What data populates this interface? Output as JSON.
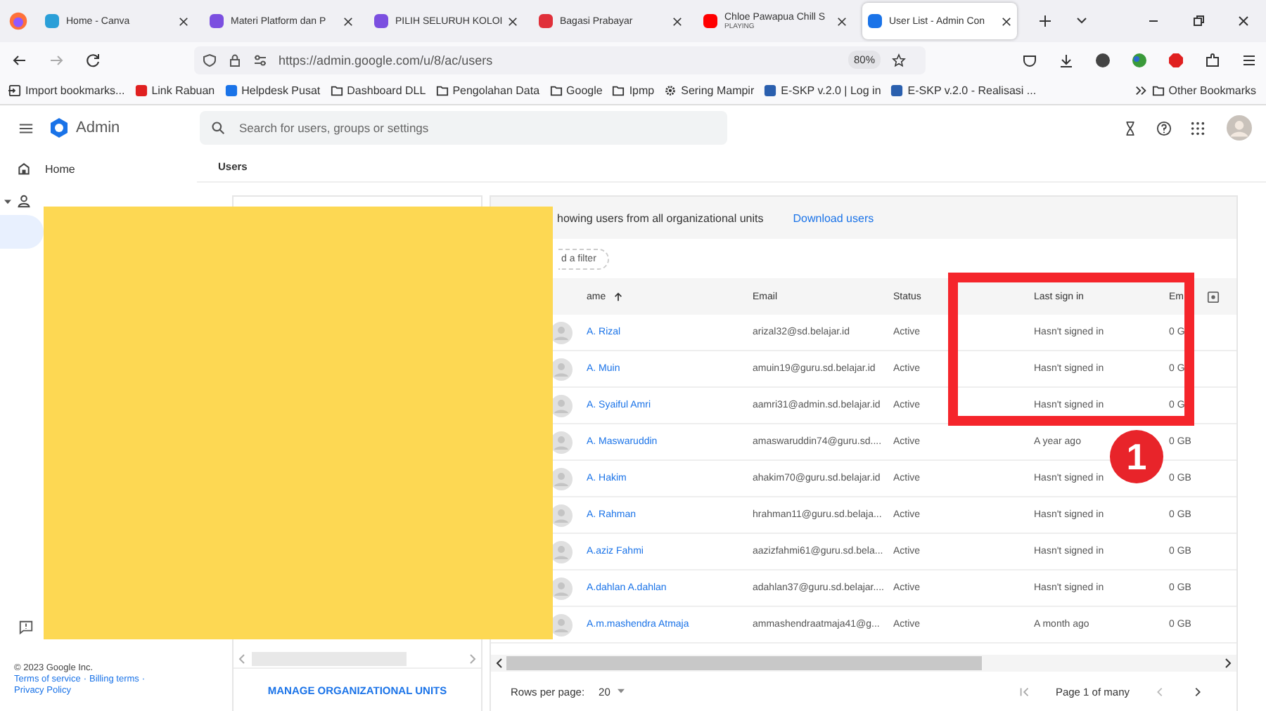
{
  "browser": {
    "tabs": [
      {
        "title": "Home - Canva",
        "selected": false,
        "color": "#2a9fd8"
      },
      {
        "title": "Materi Platform dan P",
        "selected": false,
        "color": "#7b4fe0"
      },
      {
        "title": "PILIH SELURUH KOLOI",
        "selected": false,
        "color": "#7b4fe0"
      },
      {
        "title": "Bagasi Prabayar",
        "selected": false,
        "color": "#e0303a"
      },
      {
        "title": "Chloe Pawapua Chill S",
        "subtitle": "PLAYING",
        "selected": false,
        "color": "#ff0000"
      },
      {
        "title": "User List - Admin Con",
        "selected": true,
        "color": "#1a73e8"
      }
    ],
    "address": "https://admin.google.com/u/8/ac/users",
    "zoom": "80%",
    "bookmarks": [
      {
        "label": "Import bookmarks...",
        "kind": "import"
      },
      {
        "label": "Link Rabuan",
        "kind": "site",
        "color": "#e02020"
      },
      {
        "label": "Helpdesk Pusat",
        "kind": "site",
        "color": "#1a73e8"
      },
      {
        "label": "Dashboard DLL",
        "kind": "folder"
      },
      {
        "label": "Pengolahan Data",
        "kind": "folder"
      },
      {
        "label": "Google",
        "kind": "folder"
      },
      {
        "label": "Ipmp",
        "kind": "folder"
      },
      {
        "label": "Sering Mampir",
        "kind": "gear"
      },
      {
        "label": "E-SKP v.2.0 | Log in",
        "kind": "site",
        "color": "#2a5fae"
      },
      {
        "label": "E-SKP v.2.0 - Realisasi ...",
        "kind": "site",
        "color": "#2a5fae"
      }
    ],
    "other_bookmarks": "Other Bookmarks"
  },
  "app": {
    "title": "Admin",
    "search": {
      "placeholder": "Search for users, groups or settings"
    }
  },
  "sidebar": {
    "items": [
      {
        "label": "Home",
        "kind": "home",
        "selected": false
      },
      {
        "kind": "person",
        "expanded": true,
        "children": [
          {
            "selected": true
          }
        ]
      }
    ],
    "footer": {
      "copyright": "© 2023 Google Inc.",
      "separator": "·",
      "links": [
        "Terms of service",
        "Billing terms",
        "Privacy Policy"
      ]
    }
  },
  "breadcrumb": "Users",
  "org_panel": {
    "action": "MANAGE ORGANIZATIONAL UNITS"
  },
  "users_panel": {
    "scope_text": "howing users from all organizational units",
    "download": "Download users",
    "filter_chip": "d a filter",
    "columns": [
      {
        "label": "ame",
        "sorted_ascending": true
      },
      {
        "label": "Email"
      },
      {
        "label": "Status"
      },
      {
        "label": "Last sign in"
      },
      {
        "label": "Em"
      }
    ],
    "rows": [
      {
        "name": "A. Rizal",
        "email": "arizal32@sd.belajar.id",
        "status": "Active",
        "last_sign_in": "Hasn't signed in",
        "storage": "0 G"
      },
      {
        "name": "A. Muin",
        "email": "amuin19@guru.sd.belajar.id",
        "status": "Active",
        "last_sign_in": "Hasn't signed in",
        "storage": "0 G"
      },
      {
        "name": "A. Syaiful Amri",
        "email": "aamri31@admin.sd.belajar.id",
        "status": "Active",
        "last_sign_in": "Hasn't signed in",
        "storage": "0 G"
      },
      {
        "name": "A. Maswaruddin",
        "email": "amaswaruddin74@guru.sd....",
        "status": "Active",
        "last_sign_in": "A year ago",
        "storage": "0 GB"
      },
      {
        "name": "A. Hakim",
        "email": "ahakim70@guru.sd.belajar.id",
        "status": "Active",
        "last_sign_in": "Hasn't signed in",
        "storage": "0 GB"
      },
      {
        "name": "A. Rahman",
        "email": "hrahman11@guru.sd.belaja...",
        "status": "Active",
        "last_sign_in": "Hasn't signed in",
        "storage": "0 GB"
      },
      {
        "name": "A.aziz Fahmi",
        "email": "aazizfahmi61@guru.sd.bela...",
        "status": "Active",
        "last_sign_in": "Hasn't signed in",
        "storage": "0 GB"
      },
      {
        "name": "A.dahlan A.dahlan",
        "email": "adahlan37@guru.sd.belajar....",
        "status": "Active",
        "last_sign_in": "Hasn't signed in",
        "storage": "0 GB"
      },
      {
        "name": "A.m.mashendra Atmaja",
        "email": "ammashendraatmaja41@g...",
        "status": "Active",
        "last_sign_in": "A month ago",
        "storage": "0 GB"
      }
    ],
    "pagination": {
      "rows_label": "Rows per page:",
      "rows_value": "20",
      "page": "Page 1 of many"
    }
  },
  "annotation": {
    "badge": "1"
  }
}
